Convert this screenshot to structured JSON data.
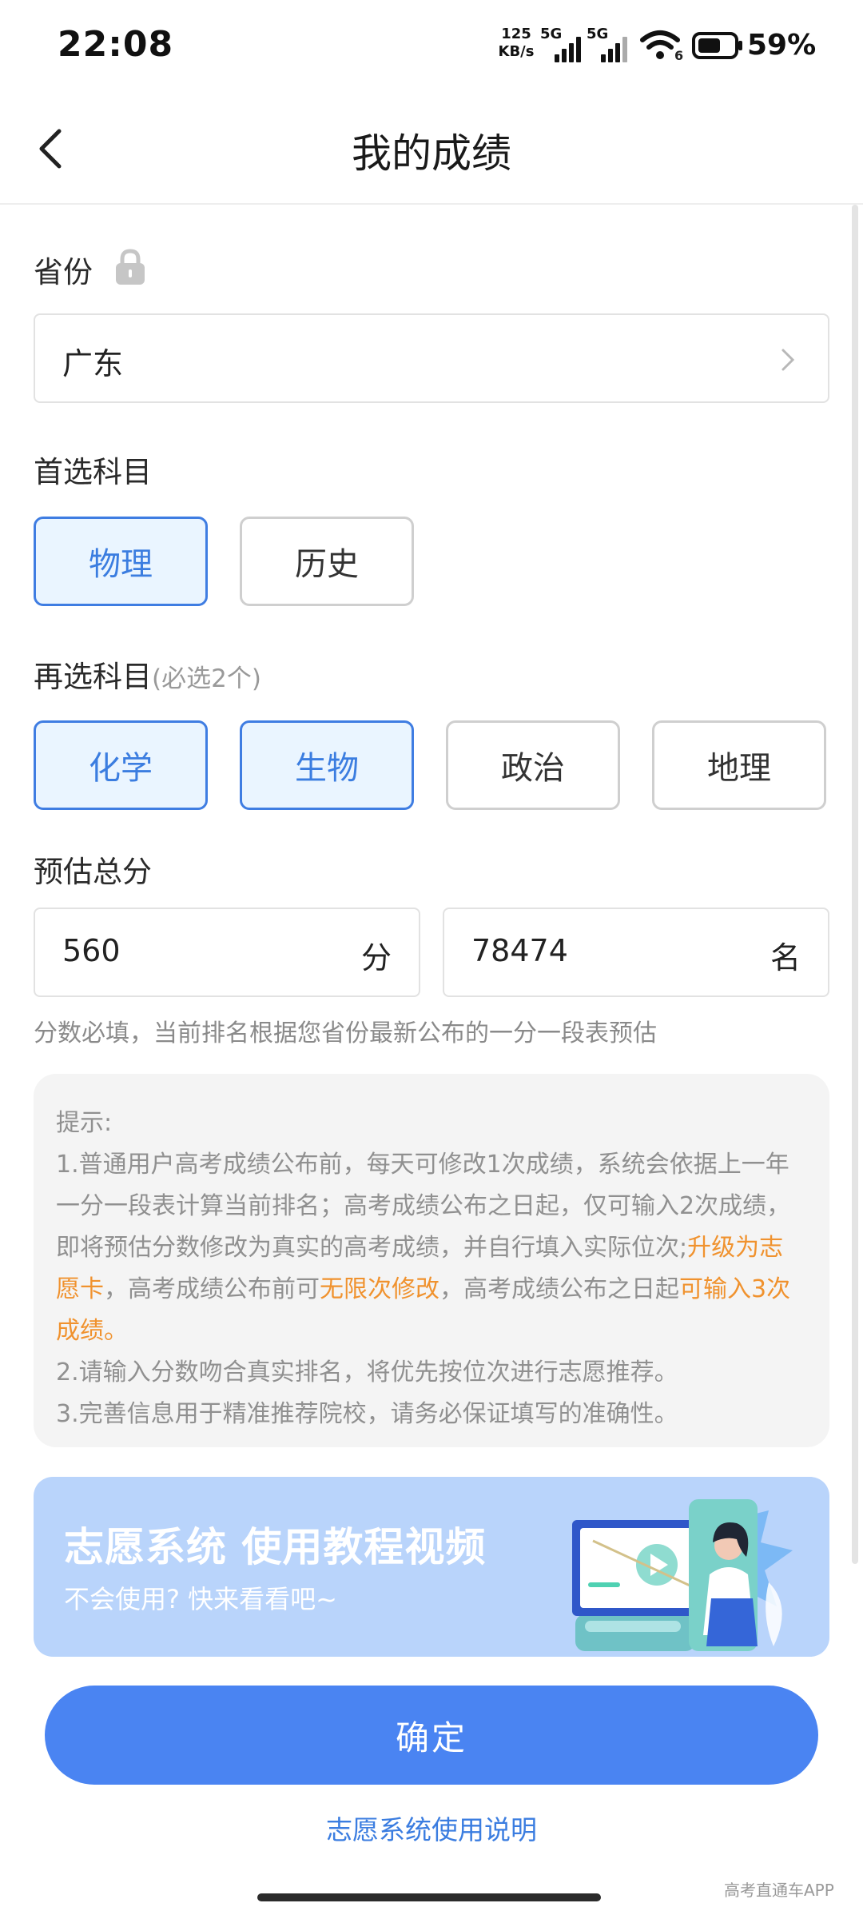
{
  "status_bar": {
    "time": "22:08",
    "net_speed_value": "125",
    "net_speed_unit": "KB/s",
    "sim1_tag": "5G",
    "sim2_tag": "5G",
    "wifi_tag": "6",
    "battery_percent": "59%"
  },
  "nav": {
    "title": "我的成绩",
    "back_icon": "chevron-left-icon"
  },
  "province": {
    "label": "省份",
    "lock_icon": "lock-icon",
    "value": "广东",
    "chevron_icon": "chevron-right-icon"
  },
  "primary_subject": {
    "label": "首选科目",
    "options": [
      {
        "label": "物理",
        "selected": true
      },
      {
        "label": "历史",
        "selected": false
      }
    ]
  },
  "secondary_subject": {
    "label": "再选科目",
    "note": "(必选2个)",
    "options": [
      {
        "label": "化学",
        "selected": true
      },
      {
        "label": "生物",
        "selected": true
      },
      {
        "label": "政治",
        "selected": false
      },
      {
        "label": "地理",
        "selected": false
      }
    ]
  },
  "score": {
    "label": "预估总分",
    "score_value": "560",
    "score_unit": "分",
    "rank_value": "78474",
    "rank_unit": "名",
    "hint": "分数必填，当前排名根据您省份最新公布的一分一段表预估"
  },
  "tips": {
    "heading": "提示:",
    "line1_a": "1.普通用户高考成绩公布前，每天可修改1次成绩，系统会依据上一年一分一段表计算当前排名；高考成绩公布之日起，仅可输入2次成绩，即将预估分数修改为真实的高考成绩，并自行填入实际位次;",
    "line1_hl1": "升级为志愿卡",
    "line1_b": "，高考成绩公布前可",
    "line1_hl2": "无限次修改",
    "line1_c": "，高考成绩公布之日起",
    "line1_hl3": "可输入3次成绩。",
    "line2": "2.请输入分数吻合真实排名，将优先按位次进行志愿推荐。",
    "line3": "3.完善信息用于精准推荐院校，请务必保证填写的准确性。"
  },
  "banner": {
    "title": "志愿系统 使用教程视频",
    "subtitle": "不会使用? 快来看看吧~",
    "illustration_icon": "video-tutorial-illustration"
  },
  "confirm_button": "确定",
  "manual_link": "志愿系统使用说明",
  "watermark": "高考直通车APP",
  "colors": {
    "accent": "#4a84f2",
    "accent_text": "#3b7de0",
    "selected_bg": "#eaf5ff",
    "highlight": "#f0922e",
    "banner_bg": "#b9d4fb"
  }
}
